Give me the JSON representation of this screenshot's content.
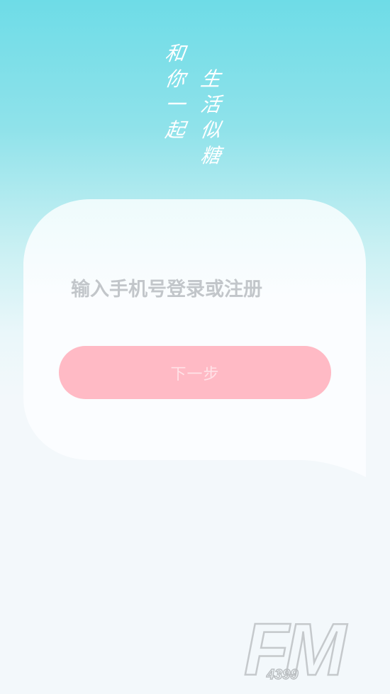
{
  "slogan": {
    "left_column": [
      "和",
      "你",
      "一",
      "起"
    ],
    "right_column": [
      "生",
      "活",
      "似",
      "糖"
    ]
  },
  "login": {
    "phone_placeholder": "输入手机号登录或注册",
    "next_label": "下一步"
  },
  "watermark": {
    "logo_text": "FM",
    "logo_number": "4399"
  },
  "colors": {
    "gradient_top": "#6edce7",
    "background": "#f3f8fb",
    "card": "#fbfdff",
    "button": "#ffbac5",
    "button_text": "#ffe2e7",
    "placeholder": "#c2c6ca"
  }
}
